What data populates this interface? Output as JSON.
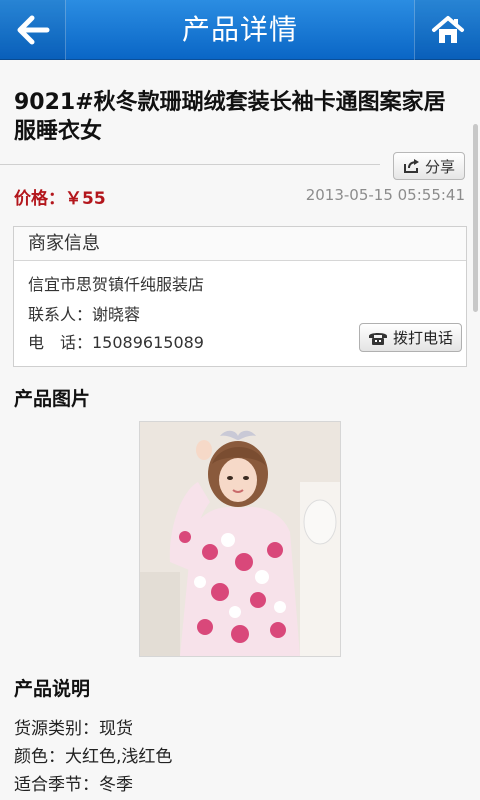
{
  "header": {
    "title": "产品详情",
    "back_icon": "back-arrow-icon",
    "home_icon": "home-icon"
  },
  "product": {
    "title": "9021#秋冬款珊瑚绒套装长袖卡通图案家居服睡衣女",
    "share_label": "分享",
    "price_label": "价格：",
    "price_value": "￥55",
    "timestamp": "2013-05-15 05:55:41"
  },
  "merchant": {
    "header": "商家信息",
    "name": "信宜市思贺镇仟纯服装店",
    "contact": "联系人：谢晓蓉",
    "phone": "电　话：15089615089",
    "call_label": "拨打电话"
  },
  "sections": {
    "images_heading": "产品图片",
    "description_heading": "产品说明"
  },
  "description": {
    "lines": [
      "货源类别：现货",
      "颜色：大红色,浅红色",
      "适合季节：冬季"
    ]
  },
  "colors": {
    "header_blue": "#0a66c6",
    "price_red": "#b3161c"
  }
}
